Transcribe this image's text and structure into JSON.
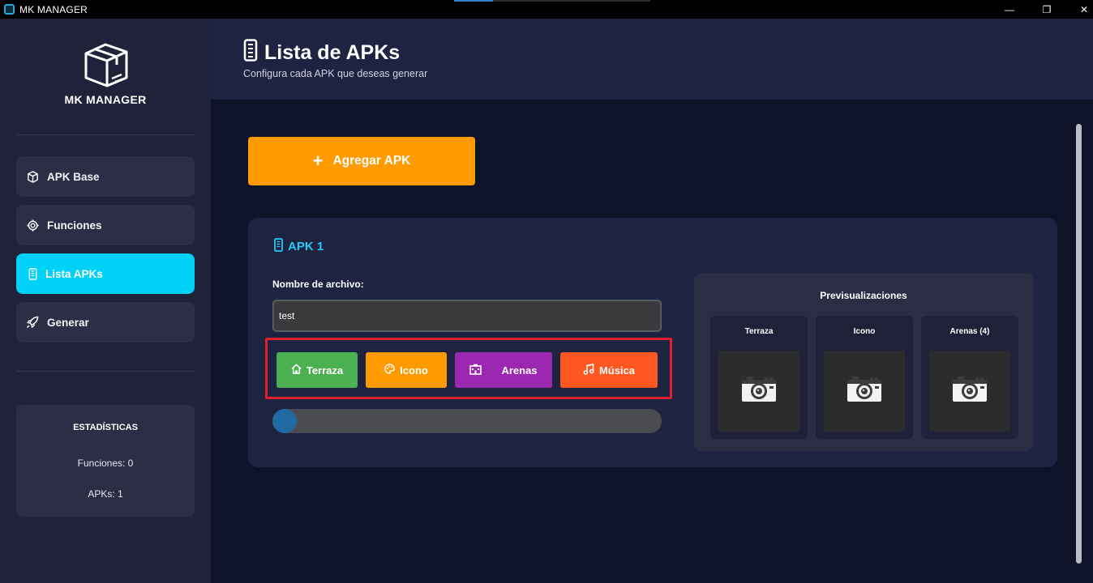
{
  "window": {
    "title": "MK MANAGER",
    "controls": {
      "minimize": "—",
      "maximize": "❐",
      "close": "✕"
    }
  },
  "sidebar": {
    "app_name": "MK MANAGER",
    "items": [
      {
        "label": "APK Base",
        "icon": "package-icon",
        "active": false
      },
      {
        "label": "Funciones",
        "icon": "gear-icon",
        "active": false
      },
      {
        "label": "Lista APKs",
        "icon": "phone-icon",
        "active": true
      },
      {
        "label": "Generar",
        "icon": "rocket-icon",
        "active": false
      }
    ],
    "stats": {
      "title": "ESTADÍSTICAS",
      "funciones": "Funciones: 0",
      "apks": "APKs: 1"
    }
  },
  "header": {
    "title": "Lista de APKs",
    "subtitle": "Configura cada APK que deseas generar"
  },
  "main": {
    "add_button": "Agregar APK",
    "apk_card": {
      "title": "APK 1",
      "field_label": "Nombre de archivo:",
      "filename_value": "test",
      "asset_buttons": [
        {
          "label": "Terraza",
          "color": "#4caf50",
          "icon": "home-icon"
        },
        {
          "label": "Icono",
          "color": "#ff9a00",
          "icon": "palette-icon"
        },
        {
          "label": "Arenas",
          "color": "#9c27b0",
          "icon": "building-icon"
        },
        {
          "label": "Música",
          "color": "#ff5722",
          "icon": "music-icon"
        }
      ],
      "progress": 0.06,
      "previews": {
        "title": "Previsualizaciones",
        "items": [
          {
            "label": "Terraza",
            "icon": "camera-icon"
          },
          {
            "label": "Icono",
            "icon": "camera-icon"
          },
          {
            "label": "Arenas (4)",
            "icon": "camera-icon"
          }
        ]
      }
    }
  },
  "colors": {
    "accent_active": "#00d1f7",
    "add_button": "#ff9a00",
    "card_title": "#26c8f4",
    "highlight": "#e0202e"
  }
}
